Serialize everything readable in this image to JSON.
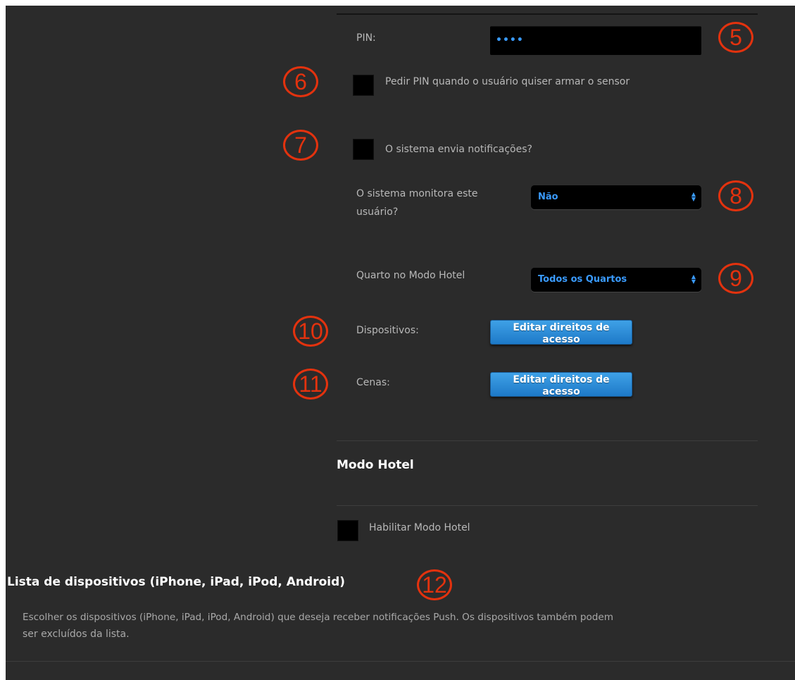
{
  "pin": {
    "label": "PIN:",
    "value": "••••"
  },
  "ask_pin": {
    "label": "Pedir PIN quando o usuário quiser armar o sensor",
    "checked": false
  },
  "notifications": {
    "label": "O sistema envia notificações?",
    "checked": false
  },
  "monitor": {
    "label_line1": "O sistema monitora este",
    "label_line2": "usuário?",
    "selected": "Não"
  },
  "hotel_room": {
    "label": "Quarto no Modo Hotel",
    "selected": "Todos os Quartos"
  },
  "devices": {
    "label": "Dispositivos:",
    "button_line1": "Editar direitos de",
    "button_line2": "acesso"
  },
  "scenes": {
    "label": "Cenas:",
    "button_line1": "Editar direitos de",
    "button_line2": "acesso"
  },
  "hotel_mode": {
    "title": "Modo Hotel",
    "enable_label": "Habilitar Modo Hotel",
    "checked": false
  },
  "device_list": {
    "title": "Lista de dispositivos (iPhone, iPad, iPod, Android)",
    "description_line1": "Escolher os dispositivos (iPhone, iPad, iPod, Android) que deseja receber notificações Push. Os dispositivos também podem",
    "description_line2": "ser excluídos da lista."
  },
  "markers": [
    "5",
    "6",
    "7",
    "8",
    "9",
    "10",
    "11",
    "12"
  ],
  "colors": {
    "background": "#2b2b2b",
    "accent_blue": "#3a9bff",
    "marker_red": "#e3320e",
    "button_blue": "#2a88d6"
  }
}
